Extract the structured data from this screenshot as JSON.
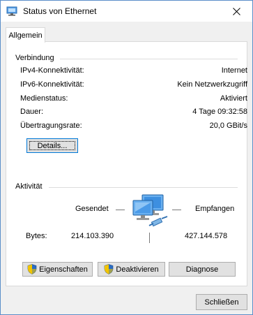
{
  "window": {
    "title": "Status von Ethernet"
  },
  "tabs": [
    {
      "label": "Allgemein",
      "selected": true
    }
  ],
  "connection": {
    "group_label": "Verbindung",
    "rows": [
      {
        "label": "IPv4-Konnektivität:",
        "value": "Internet"
      },
      {
        "label": "IPv6-Konnektivität:",
        "value": "Kein Netzwerkzugriff"
      },
      {
        "label": "Medienstatus:",
        "value": "Aktiviert"
      },
      {
        "label": "Dauer:",
        "value": "4 Tage 09:32:58"
      },
      {
        "label": "Übertragungsrate:",
        "value": "20,0 GBit/s"
      }
    ],
    "details_button": "Details..."
  },
  "activity": {
    "group_label": "Aktivität",
    "sent_label": "Gesendet",
    "received_label": "Empfangen",
    "bytes_label": "Bytes:",
    "bytes_sent": "214.103.390",
    "bytes_received": "427.144.578",
    "icon": "network-computers-icon"
  },
  "actions": {
    "properties_button": "Eigenschaften",
    "deactivate_button": "Deaktivieren",
    "diagnose_button": "Diagnose"
  },
  "footer": {
    "close_button": "Schließen"
  },
  "colors": {
    "window_border": "#5b8ec9",
    "focus_border": "#0078d7",
    "button_bg": "#e1e1e1",
    "dialog_bg": "#f0f0f0"
  }
}
